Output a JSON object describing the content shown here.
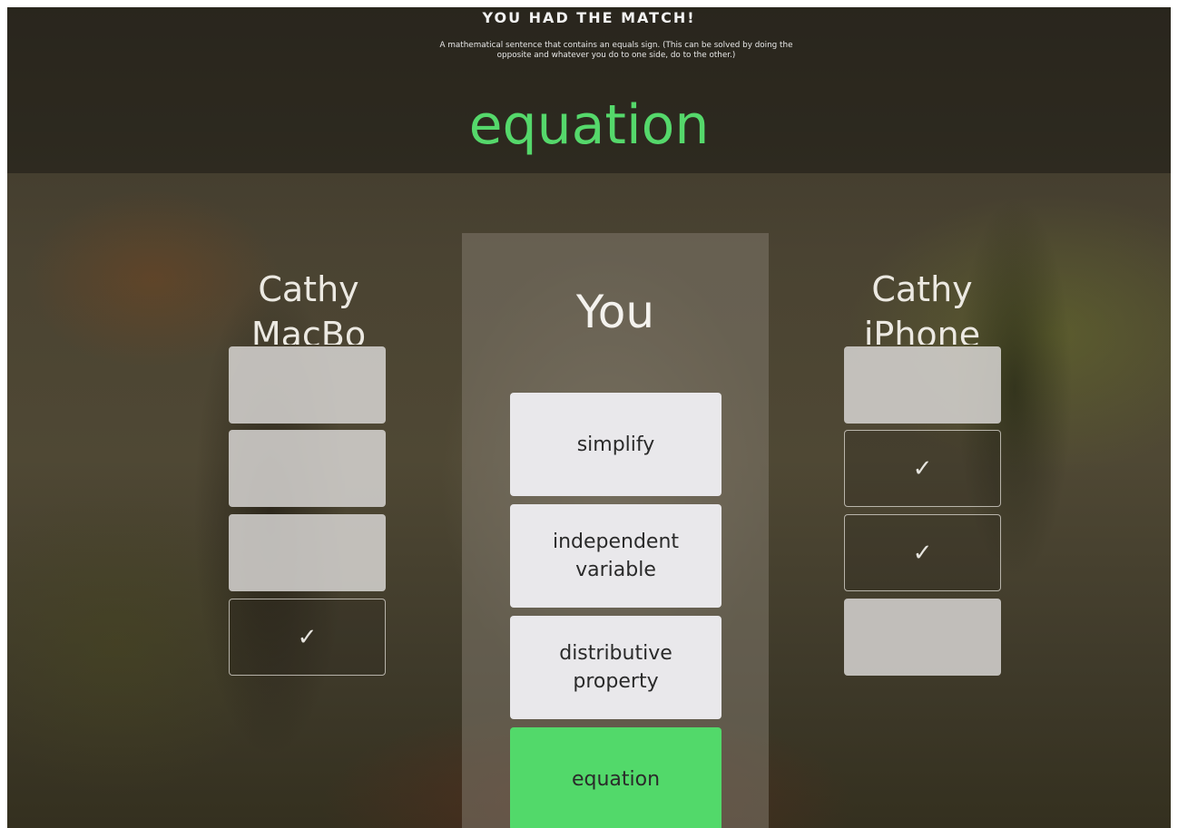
{
  "header": {
    "title": "YOU HAD THE MATCH!",
    "definition": "A mathematical sentence that contains an equals sign. (This can be solved by doing the opposite and whatever you do to one side, do to the other.)",
    "answer": "equation"
  },
  "colors": {
    "answer_green": "#55d86b",
    "correct_tile": "#52d96a",
    "tile_light": "#e9e8eb"
  },
  "players": {
    "left": {
      "name": "Cathy MacBo",
      "tiles": [
        {
          "state": "filled"
        },
        {
          "state": "filled"
        },
        {
          "state": "filled"
        },
        {
          "state": "matched",
          "icon": "check-icon",
          "glyph": "✓"
        }
      ]
    },
    "you": {
      "name": "You",
      "choices": [
        {
          "label": "simplify",
          "state": "default"
        },
        {
          "label": "independent variable",
          "state": "default"
        },
        {
          "label": "distributive property",
          "state": "default"
        },
        {
          "label": "equation",
          "state": "correct"
        }
      ]
    },
    "right": {
      "name": "Cathy iPhone",
      "tiles": [
        {
          "state": "filled"
        },
        {
          "state": "matched",
          "icon": "check-icon",
          "glyph": "✓"
        },
        {
          "state": "matched",
          "icon": "check-icon",
          "glyph": "✓"
        },
        {
          "state": "filled"
        }
      ]
    }
  }
}
